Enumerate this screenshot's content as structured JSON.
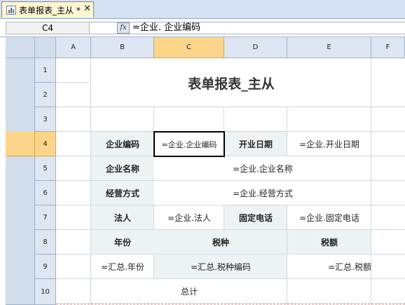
{
  "tab": {
    "title": "表单报表_主从 *",
    "close": "✕",
    "icon": "bar-chart-icon"
  },
  "formula_bar": {
    "cell_ref": "C4",
    "fx_label": "fx",
    "formula": "=企业. 企业编码"
  },
  "columns": [
    "A",
    "B",
    "C",
    "D",
    "E",
    "F"
  ],
  "rows": [
    "1",
    "2",
    "3",
    "4",
    "5",
    "6",
    "7",
    "8",
    "9",
    "10"
  ],
  "selected_cell": "C4",
  "sheet": {
    "title": "表单报表_主从",
    "company_code_label": "企业编码",
    "company_code_value": "=企业.企业编码",
    "open_date_label": "开业日期",
    "open_date_value": "=企业.开业日期",
    "company_name_label": "企业名称",
    "company_name_value": "=企业.企业名称",
    "business_mode_label": "经营方式",
    "business_mode_value": "=企业.经营方式",
    "legal_person_label": "法人",
    "legal_person_value": "=企业.法人",
    "phone_label": "固定电话",
    "phone_value": "=企业.固定电话",
    "year_label": "年份",
    "tax_type_label": "税种",
    "tax_amount_label": "税额",
    "year_value": "=汇总.年份",
    "tax_code_value": "=汇总.税种编码",
    "tax_amount_value": "=汇总.税额",
    "total_label": "总计"
  },
  "colors": {
    "selected_header": "#fbd58a",
    "label_shade": "#edf3f3",
    "header_bg": "#dde6f2"
  }
}
